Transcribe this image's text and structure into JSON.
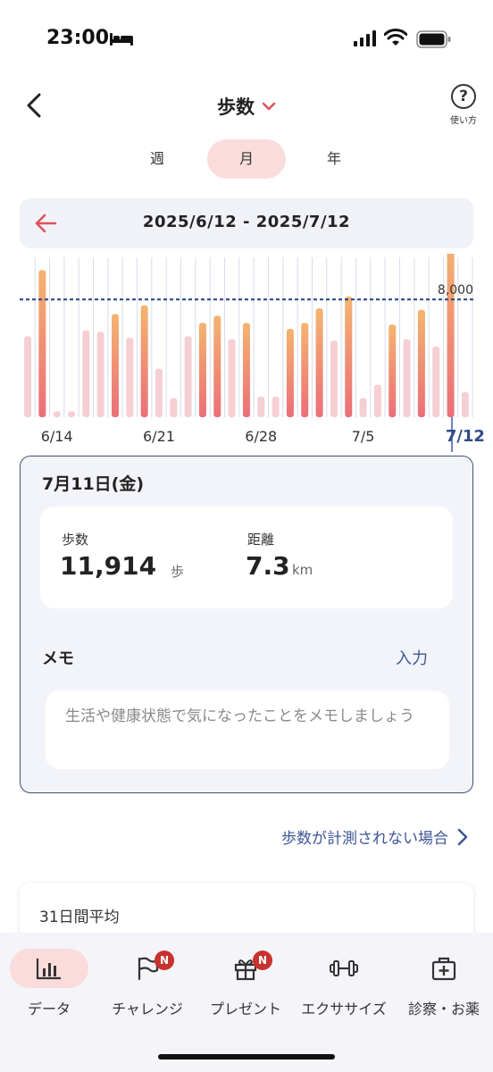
{
  "status_bar": {
    "time": "23:00"
  },
  "header": {
    "title": "歩数",
    "help_label": "使い方"
  },
  "period_tabs": [
    {
      "label": "週",
      "active": false
    },
    {
      "label": "月",
      "active": true
    },
    {
      "label": "年",
      "active": false
    }
  ],
  "date_range": "2025/6/12 - 2025/7/12",
  "chart_data": {
    "type": "bar",
    "categories": [
      "6/12",
      "6/13",
      "6/14",
      "6/15",
      "6/16",
      "6/17",
      "6/18",
      "6/19",
      "6/20",
      "6/21",
      "6/22",
      "6/23",
      "6/24",
      "6/25",
      "6/26",
      "6/27",
      "6/28",
      "6/29",
      "6/30",
      "7/1",
      "7/2",
      "7/3",
      "7/4",
      "7/5",
      "7/6",
      "7/7",
      "7/8",
      "7/9",
      "7/10",
      "7/11",
      "7/12"
    ],
    "x_tick_labels": [
      "6/14",
      "6/21",
      "6/28",
      "7/5",
      "7/12"
    ],
    "values": [
      5500,
      10000,
      400,
      400,
      5900,
      5800,
      7000,
      5400,
      7600,
      3300,
      1300,
      5500,
      6400,
      6900,
      5300,
      6400,
      1400,
      1400,
      6000,
      6400,
      7400,
      5200,
      8200,
      1300,
      2200,
      6300,
      5300,
      7300,
      4800,
      11914,
      1700
    ],
    "goal_met": [
      false,
      true,
      false,
      false,
      false,
      false,
      true,
      false,
      true,
      false,
      false,
      false,
      true,
      true,
      false,
      true,
      false,
      false,
      true,
      true,
      true,
      false,
      true,
      false,
      false,
      true,
      false,
      true,
      false,
      true,
      false
    ],
    "reference_line": {
      "value": 8000,
      "label": "8,000"
    },
    "selected_category": "7/12",
    "ylim": [
      0,
      10500
    ],
    "colors": {
      "goal_met_top": "#f4b470",
      "goal_met_bottom": "#ec6e78",
      "below_goal": "#f6cfd3",
      "reference_line": "#2f4a87",
      "selected_line": "#3a5ba8",
      "gridline": "#d7dcea"
    }
  },
  "detail": {
    "date_label": "7月11日(金)",
    "steps_label": "歩数",
    "steps_value": "11,914",
    "steps_unit": "歩",
    "distance_label": "距離",
    "distance_value": "7.3",
    "distance_unit": "km",
    "memo_label": "メモ",
    "memo_action": "入力",
    "memo_placeholder": "生活や健康状態で気になったことをメモしましょう"
  },
  "no_measure_link": "歩数が計測されない場合",
  "average_card": {
    "label": "31日間平均"
  },
  "tab_bar": [
    {
      "label": "データ",
      "icon": "bar-chart-icon",
      "badge": "",
      "active": true
    },
    {
      "label": "チャレンジ",
      "icon": "flag-icon",
      "badge": "N",
      "active": false
    },
    {
      "label": "プレゼント",
      "icon": "gift-icon",
      "badge": "N",
      "active": false
    },
    {
      "label": "エクササイズ",
      "icon": "dumbbell-icon",
      "badge": "",
      "active": false
    },
    {
      "label": "診察・お薬",
      "icon": "medical-bag-icon",
      "badge": "",
      "active": false
    }
  ],
  "accent_color": "#e0505a",
  "link_color": "#3e5594"
}
